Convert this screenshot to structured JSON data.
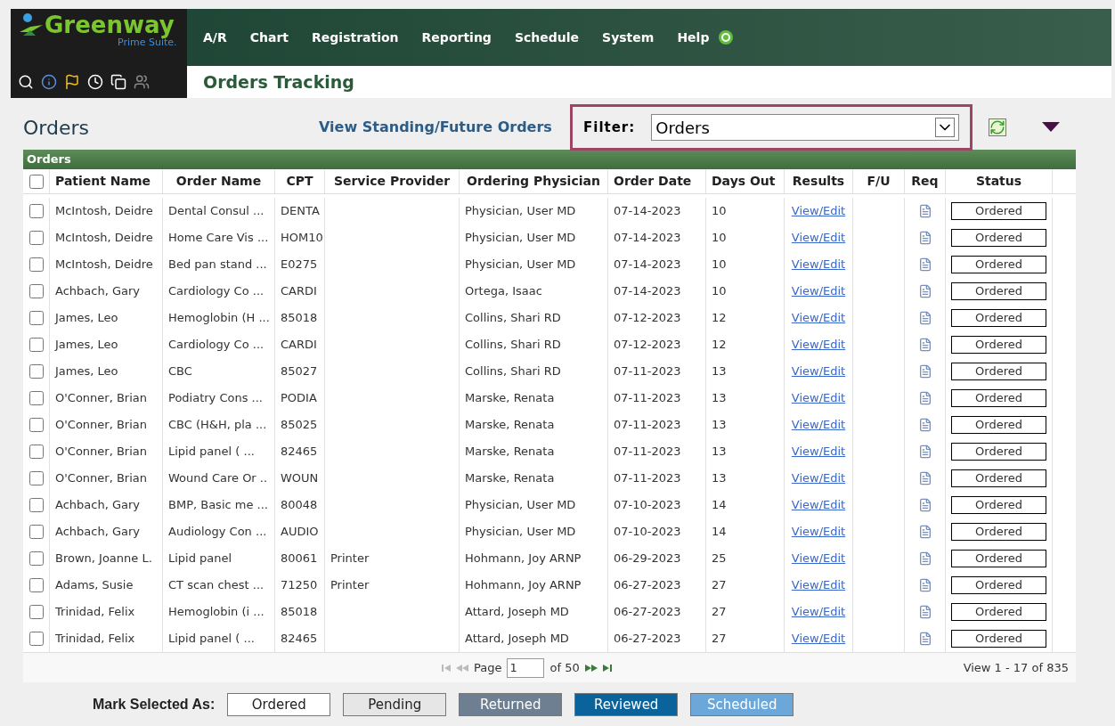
{
  "logo": {
    "name": "Greenway",
    "sub": "Prime Suite."
  },
  "menu": [
    "A/R",
    "Chart",
    "Registration",
    "Reporting",
    "Schedule",
    "System",
    "Help"
  ],
  "page_title": "Orders Tracking",
  "heading": "Orders",
  "standing_link": "View Standing/Future Orders",
  "filter": {
    "label": "Filter:",
    "value": "Orders"
  },
  "grid": {
    "title": "Orders",
    "select_all": false,
    "columns": [
      "Patient Name",
      "Order Name",
      "CPT",
      "Service Provider",
      "Ordering Physician",
      "Order Date",
      "Days Out",
      "Results",
      "F/U",
      "Req",
      "Status"
    ],
    "rows": [
      {
        "checked": false,
        "cells": [
          "McIntosh, Deidre",
          "Dental Consul ...",
          "DENTA",
          "",
          "Physician, User MD",
          "07-14-2023",
          "10",
          "View/Edit",
          "",
          "",
          "Ordered"
        ]
      },
      {
        "checked": false,
        "cells": [
          "McIntosh, Deidre",
          "Home Care Vis ...",
          "HOM10",
          "",
          "Physician, User MD",
          "07-14-2023",
          "10",
          "View/Edit",
          "",
          "",
          "Ordered"
        ]
      },
      {
        "checked": false,
        "cells": [
          "McIntosh, Deidre",
          "Bed pan stand ...",
          "E0275",
          "",
          "Physician, User MD",
          "07-14-2023",
          "10",
          "View/Edit",
          "",
          "",
          "Ordered"
        ]
      },
      {
        "checked": false,
        "cells": [
          "Achbach, Gary",
          "Cardiology Co ...",
          "CARDI",
          "",
          "Ortega, Isaac",
          "07-14-2023",
          "10",
          "View/Edit",
          "",
          "",
          "Ordered"
        ]
      },
      {
        "checked": false,
        "cells": [
          "James, Leo",
          "Hemoglobin (H ...",
          "85018",
          "",
          "Collins, Shari RD",
          "07-12-2023",
          "12",
          "View/Edit",
          "",
          "",
          "Ordered"
        ]
      },
      {
        "checked": false,
        "cells": [
          "James, Leo",
          "Cardiology Co ...",
          "CARDI",
          "",
          "Collins, Shari RD",
          "07-12-2023",
          "12",
          "View/Edit",
          "",
          "",
          "Ordered"
        ]
      },
      {
        "checked": false,
        "cells": [
          "James, Leo",
          "CBC",
          "85027",
          "",
          "Collins, Shari RD",
          "07-11-2023",
          "13",
          "View/Edit",
          "",
          "",
          "Ordered"
        ]
      },
      {
        "checked": false,
        "cells": [
          "O'Conner, Brian",
          "Podiatry Cons ...",
          "PODIA",
          "",
          "Marske, Renata",
          "07-11-2023",
          "13",
          "View/Edit",
          "",
          "",
          "Ordered"
        ]
      },
      {
        "checked": false,
        "cells": [
          "O'Conner, Brian",
          "CBC (H&H, pla ...",
          "85025",
          "",
          "Marske, Renata",
          "07-11-2023",
          "13",
          "View/Edit",
          "",
          "",
          "Ordered"
        ]
      },
      {
        "checked": false,
        "cells": [
          "O'Conner, Brian",
          "Lipid panel ( ...",
          "82465",
          "",
          "Marske, Renata",
          "07-11-2023",
          "13",
          "View/Edit",
          "",
          "",
          "Ordered"
        ]
      },
      {
        "checked": false,
        "cells": [
          "O'Conner, Brian",
          "Wound Care Or ..",
          "WOUN",
          "",
          "Marske, Renata",
          "07-11-2023",
          "13",
          "View/Edit",
          "",
          "",
          "Ordered"
        ]
      },
      {
        "checked": false,
        "cells": [
          "Achbach, Gary",
          "BMP, Basic me ...",
          "80048",
          "",
          "Physician, User MD",
          "07-10-2023",
          "14",
          "View/Edit",
          "",
          "",
          "Ordered"
        ]
      },
      {
        "checked": false,
        "cells": [
          "Achbach, Gary",
          "Audiology Con ...",
          "AUDIO",
          "",
          "Physician, User MD",
          "07-10-2023",
          "14",
          "View/Edit",
          "",
          "",
          "Ordered"
        ]
      },
      {
        "checked": false,
        "cells": [
          "Brown, Joanne L.",
          "Lipid panel",
          "80061",
          "Printer",
          "Hohmann, Joy ARNP",
          "06-29-2023",
          "25",
          "View/Edit",
          "",
          "",
          "Ordered"
        ]
      },
      {
        "checked": false,
        "cells": [
          "Adams, Susie",
          "CT scan chest ...",
          "71250",
          "Printer",
          "Hohmann, Joy ARNP",
          "06-27-2023",
          "27",
          "View/Edit",
          "",
          "",
          "Ordered"
        ]
      },
      {
        "checked": false,
        "cells": [
          "Trinidad, Felix",
          "Hemoglobin (i ...",
          "85018",
          "",
          "Attard, Joseph MD",
          "06-27-2023",
          "27",
          "View/Edit",
          "",
          "",
          "Ordered"
        ]
      },
      {
        "checked": false,
        "cells": [
          "Trinidad, Felix",
          "Lipid panel ( ...",
          "82465",
          "",
          "Attard, Joseph MD",
          "06-27-2023",
          "27",
          "View/Edit",
          "",
          "",
          "Ordered"
        ]
      }
    ],
    "pager": {
      "page_label": "Page",
      "page": "1",
      "of": "of 50",
      "summary": "View 1 - 17 of 835"
    }
  },
  "mark": {
    "label": "Mark Selected As:",
    "buttons": [
      {
        "label": "Ordered",
        "color": "#ffffff"
      },
      {
        "label": "Pending",
        "color": "#e6e6e6"
      },
      {
        "label": "Returned",
        "color": "#6d7f90"
      },
      {
        "label": "Reviewed",
        "color": "#0b639b"
      },
      {
        "label": "Scheduled",
        "color": "#6ba7d8"
      }
    ]
  }
}
